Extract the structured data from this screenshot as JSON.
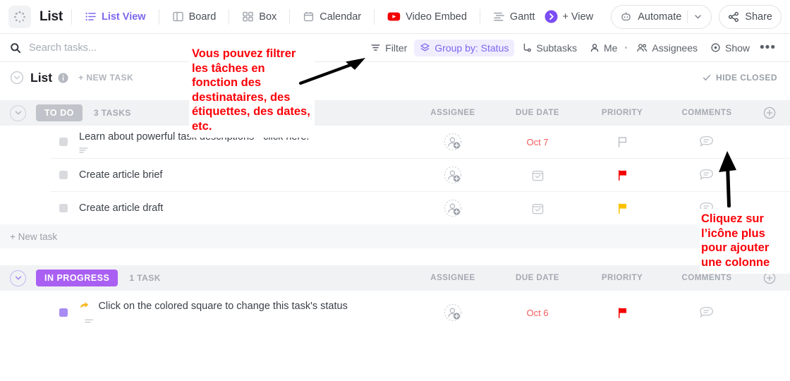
{
  "viewbar": {
    "logo_icon": "clickup-spinner-icon",
    "title": "List",
    "views": [
      {
        "label": "List View",
        "icon": "list-view-icon",
        "active": true
      },
      {
        "label": "Board",
        "icon": "board-icon",
        "active": false
      },
      {
        "label": "Box",
        "icon": "box-icon",
        "active": false
      },
      {
        "label": "Calendar",
        "icon": "calendar-icon",
        "active": false
      },
      {
        "label": "Video Embed",
        "icon": "youtube-icon",
        "active": false
      },
      {
        "label": "Gantt",
        "icon": "gantt-icon",
        "active": false
      }
    ],
    "next_views_icon": "chevron-right-circle-icon",
    "add_view_label": "+ View",
    "automate_label": "Automate",
    "automate_icon": "robot-icon",
    "automate_caret_icon": "chevron-down-icon",
    "share_label": "Share",
    "share_icon": "share-icon"
  },
  "filterbar": {
    "search_placeholder": "Search tasks...",
    "search_value": "",
    "search_icon": "search-icon",
    "search_caret_icon": "chevron-down-icon",
    "items": [
      {
        "label": "Filter",
        "icon": "filter-icon",
        "highlight": false
      },
      {
        "label": "Group by: Status",
        "icon": "layers-icon",
        "highlight": true
      },
      {
        "label": "Subtasks",
        "icon": "subtasks-icon",
        "highlight": false
      },
      {
        "label": "Me",
        "icon": "person-icon",
        "highlight": false
      },
      {
        "label": "Assignees",
        "icon": "people-icon",
        "highlight": false
      },
      {
        "label": "Show",
        "icon": "eye-icon",
        "highlight": false
      }
    ],
    "more_label": "•••"
  },
  "list_header": {
    "caret_icon": "chevron-down-circle-icon",
    "name": "List",
    "info_icon": "info-icon",
    "new_task_label": "+ NEW TASK",
    "hide_closed_label": "HIDE CLOSED",
    "hide_closed_icon": "check-icon"
  },
  "columns": {
    "assignee": "ASSIGNEE",
    "due_date": "DUE DATE",
    "priority": "PRIORITY",
    "comments": "COMMENTS",
    "add_column_icon": "plus-circle-icon"
  },
  "groups": [
    {
      "status": "TO DO",
      "status_color": "#c0c3c9",
      "count_label": "3 TASKS",
      "caret_style": "gray",
      "tasks": [
        {
          "name": "Learn about powerful task descriptions - click here!",
          "checkbox_color": "#d9dadd",
          "has_description_icon": true,
          "description_icon": "description-lines-icon",
          "assignee_icon": "add-assignee-icon",
          "due_date": "Oct 7",
          "due_date_overdue": true,
          "due_date_icon": "",
          "priority_icon": "flag-outline-icon",
          "priority_color": "#b8bcc3",
          "comments_icon": "comment-icon"
        },
        {
          "name": "Create article brief",
          "checkbox_color": "#d9dadd",
          "has_description_icon": false,
          "assignee_icon": "add-assignee-icon",
          "due_date": "",
          "due_date_overdue": false,
          "due_date_icon": "calendar-check-icon",
          "priority_icon": "flag-filled-icon",
          "priority_color": "#f50000",
          "comments_icon": "comment-icon"
        },
        {
          "name": "Create article draft",
          "checkbox_color": "#d9dadd",
          "has_description_icon": false,
          "assignee_icon": "add-assignee-icon",
          "due_date": "",
          "due_date_overdue": false,
          "due_date_icon": "calendar-check-icon",
          "priority_icon": "flag-filled-icon",
          "priority_color": "#fcc200",
          "comments_icon": "comment-icon"
        }
      ],
      "new_task_label": "+ New task"
    },
    {
      "status": "IN PROGRESS",
      "status_color": "#a960f2",
      "count_label": "1 TASK",
      "caret_style": "purple",
      "tasks": [
        {
          "name": "Click on the colored square to change this task's status",
          "checkbox_color": "#a98bf5",
          "leading_icon": "pointing-hand-icon",
          "has_description_icon": true,
          "description_icon": "description-lines-icon",
          "assignee_icon": "add-assignee-icon",
          "due_date": "Oct 6",
          "due_date_overdue": true,
          "due_date_icon": "",
          "priority_icon": "flag-filled-icon",
          "priority_color": "#f50000",
          "comments_icon": "comment-icon"
        }
      ],
      "new_task_label": ""
    }
  ],
  "annotations": {
    "color": "#fb0007",
    "filter_note": "Vous pouvez filtrer les tâches en fonction des destinataires, des étiquettes, des dates, etc.",
    "plus_note": "Cliquez sur l’icône plus pour ajouter une colonne",
    "arrow_filter_icon": "arrow-up-right-icon",
    "arrow_plus_icon": "arrow-up-icon"
  }
}
